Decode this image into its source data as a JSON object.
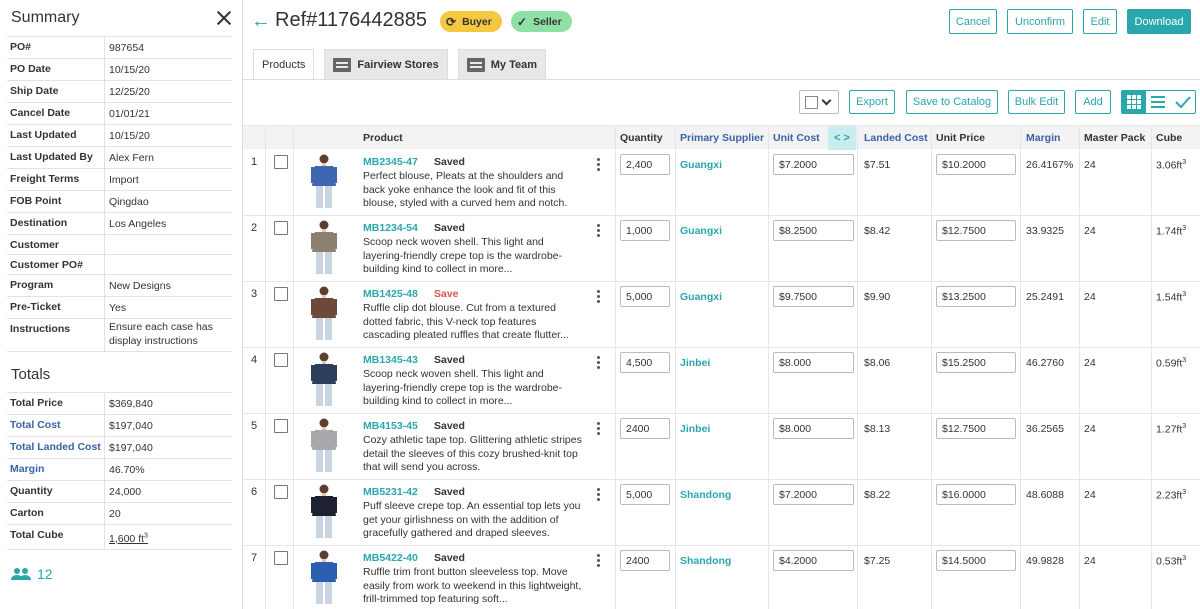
{
  "summary": {
    "title": "Summary",
    "rows": [
      {
        "label": "PO#",
        "value": "987654"
      },
      {
        "label": "PO Date",
        "value": "10/15/20"
      },
      {
        "label": "Ship Date",
        "value": "12/25/20"
      },
      {
        "label": "Cancel Date",
        "value": "01/01/21"
      },
      {
        "label": "Last Updated",
        "value": "10/15/20"
      },
      {
        "label": "Last Updated By",
        "value": "Alex Fern"
      },
      {
        "label": "Freight Terms",
        "value": "Import"
      },
      {
        "label": "FOB Point",
        "value": "Qingdao"
      },
      {
        "label": "Destination",
        "value": "Los Angeles"
      },
      {
        "label": "Customer",
        "value": ""
      },
      {
        "label": "Customer PO#",
        "value": ""
      },
      {
        "label": "Program",
        "value": "New Designs"
      },
      {
        "label": "Pre-Ticket",
        "value": "Yes"
      },
      {
        "label": "Instructions",
        "value": "Ensure each case has display instructions"
      }
    ]
  },
  "totals": {
    "title": "Totals",
    "rows": [
      {
        "label": "Total Price",
        "value": "$369,840"
      },
      {
        "label": "Total Cost",
        "value": "$197,040"
      },
      {
        "label": "Total Landed Cost",
        "value": "$197,040"
      },
      {
        "label": "Margin",
        "value": "46.70%"
      },
      {
        "label": "Quantity",
        "value": "24,000"
      },
      {
        "label": "Carton",
        "value": "20"
      },
      {
        "label": "Total Cube",
        "value": "1,600 ft",
        "sup": "3"
      }
    ]
  },
  "team_count": "12",
  "header": {
    "ref": "Ref#1176442885",
    "buyer_badge": "Buyer",
    "seller_badge": "Seller",
    "cancel": "Cancel",
    "unconfirm": "Unconfirm",
    "edit": "Edit",
    "download": "Download"
  },
  "tabs": [
    {
      "label": "Products"
    },
    {
      "label": "Fairview Stores"
    },
    {
      "label": "My Team"
    }
  ],
  "toolbar": {
    "export": "Export",
    "save_catalog": "Save to Catalog",
    "bulk_edit": "Bulk Edit",
    "add": "Add"
  },
  "columns": {
    "product": "Product",
    "quantity": "Quantity",
    "primary_supplier": "Primary Supplier",
    "unit_cost": "Unit Cost",
    "arrows": "< >",
    "landed_cost": "Landed Cost",
    "unit_price": "Unit Price",
    "margin": "Margin",
    "master_pack": "Master Pack",
    "cube": "Cube"
  },
  "rows": [
    {
      "num": "1",
      "sku": "MB2345-47",
      "status": "Saved",
      "desc": "Perfect blouse, Pleats at the shoulders and back yoke enhance the look and fit of this blouse, styled with a curved hem and notch.",
      "qty": "2,400",
      "supplier": "Guangxi",
      "unit_cost": "$7.2000",
      "landed": "$7.51",
      "unit_price": "$10.2000",
      "margin": "26.4167%",
      "pack": "24",
      "cube": "3.06ft",
      "color": "#3d68b0"
    },
    {
      "num": "2",
      "sku": "MB1234-54",
      "status": "Saved",
      "desc": "Scoop neck woven shell. This light and layering-friendly crepe top is the wardrobe-building kind to collect in more...",
      "qty": "1,000",
      "supplier": "Guangxi",
      "unit_cost": "$8.2500",
      "landed": "$8.42",
      "unit_price": "$12.7500",
      "margin": "33.9325",
      "pack": "24",
      "cube": "1.74ft",
      "color": "#8a8170"
    },
    {
      "num": "3",
      "sku": "MB1425-48",
      "status": "Save",
      "desc": "Ruffle clip dot blouse. Cut from a textured dotted fabric, this V-neck top features cascading pleated ruffles that create flutter...",
      "qty": "5,000",
      "supplier": "Guangxi",
      "unit_cost": "$9.7500",
      "landed": "$9.90",
      "unit_price": "$13.2500",
      "margin": "25.2491",
      "pack": "24",
      "cube": "1.54ft",
      "color": "#6b4a3a"
    },
    {
      "num": "4",
      "sku": "MB1345-43",
      "status": "Saved",
      "desc": "Scoop neck woven shell. This light and layering-friendly crepe top is the wardrobe-building kind to collect in more...",
      "qty": "4,500",
      "supplier": "Jinbei",
      "unit_cost": "$8.000",
      "landed": "$8.06",
      "unit_price": "$15.2500",
      "margin": "46.2760",
      "pack": "24",
      "cube": "0.59ft",
      "color": "#2c3e5c"
    },
    {
      "num": "5",
      "sku": "MB4153-45",
      "status": "Saved",
      "desc": "Cozy athletic tape top. Glittering athletic stripes detail the sleeves of this cozy brushed-knit top that will send you across.",
      "qty": "2400",
      "supplier": "Jinbei",
      "unit_cost": "$8.000",
      "landed": "$8.13",
      "unit_price": "$12.7500",
      "margin": "36.2565",
      "pack": "24",
      "cube": "1.27ft",
      "color": "#a9a9ad"
    },
    {
      "num": "6",
      "sku": "MB5231-42",
      "status": "Saved",
      "desc": "Puff sleeve crepe top. An essential top lets you get your girlishness on with the addition of gracefully gathered and draped sleeves.",
      "qty": "5,000",
      "supplier": "Shandong",
      "unit_cost": "$7.2000",
      "landed": "$8.22",
      "unit_price": "$16.0000",
      "margin": "48.6088",
      "pack": "24",
      "cube": "2.23ft",
      "color": "#1e2230"
    },
    {
      "num": "7",
      "sku": "MB5422-40",
      "status": "Saved",
      "desc": "Ruffle trim front button sleeveless top. Move easily from work to weekend in this lightweight, frill-trimmed top featuring soft...",
      "qty": "2400",
      "supplier": "Shandong",
      "unit_cost": "$4.2000",
      "landed": "$7.25",
      "unit_price": "$14.5000",
      "margin": "49.9828",
      "pack": "24",
      "cube": "0.53ft",
      "color": "#2a5fb0"
    }
  ]
}
